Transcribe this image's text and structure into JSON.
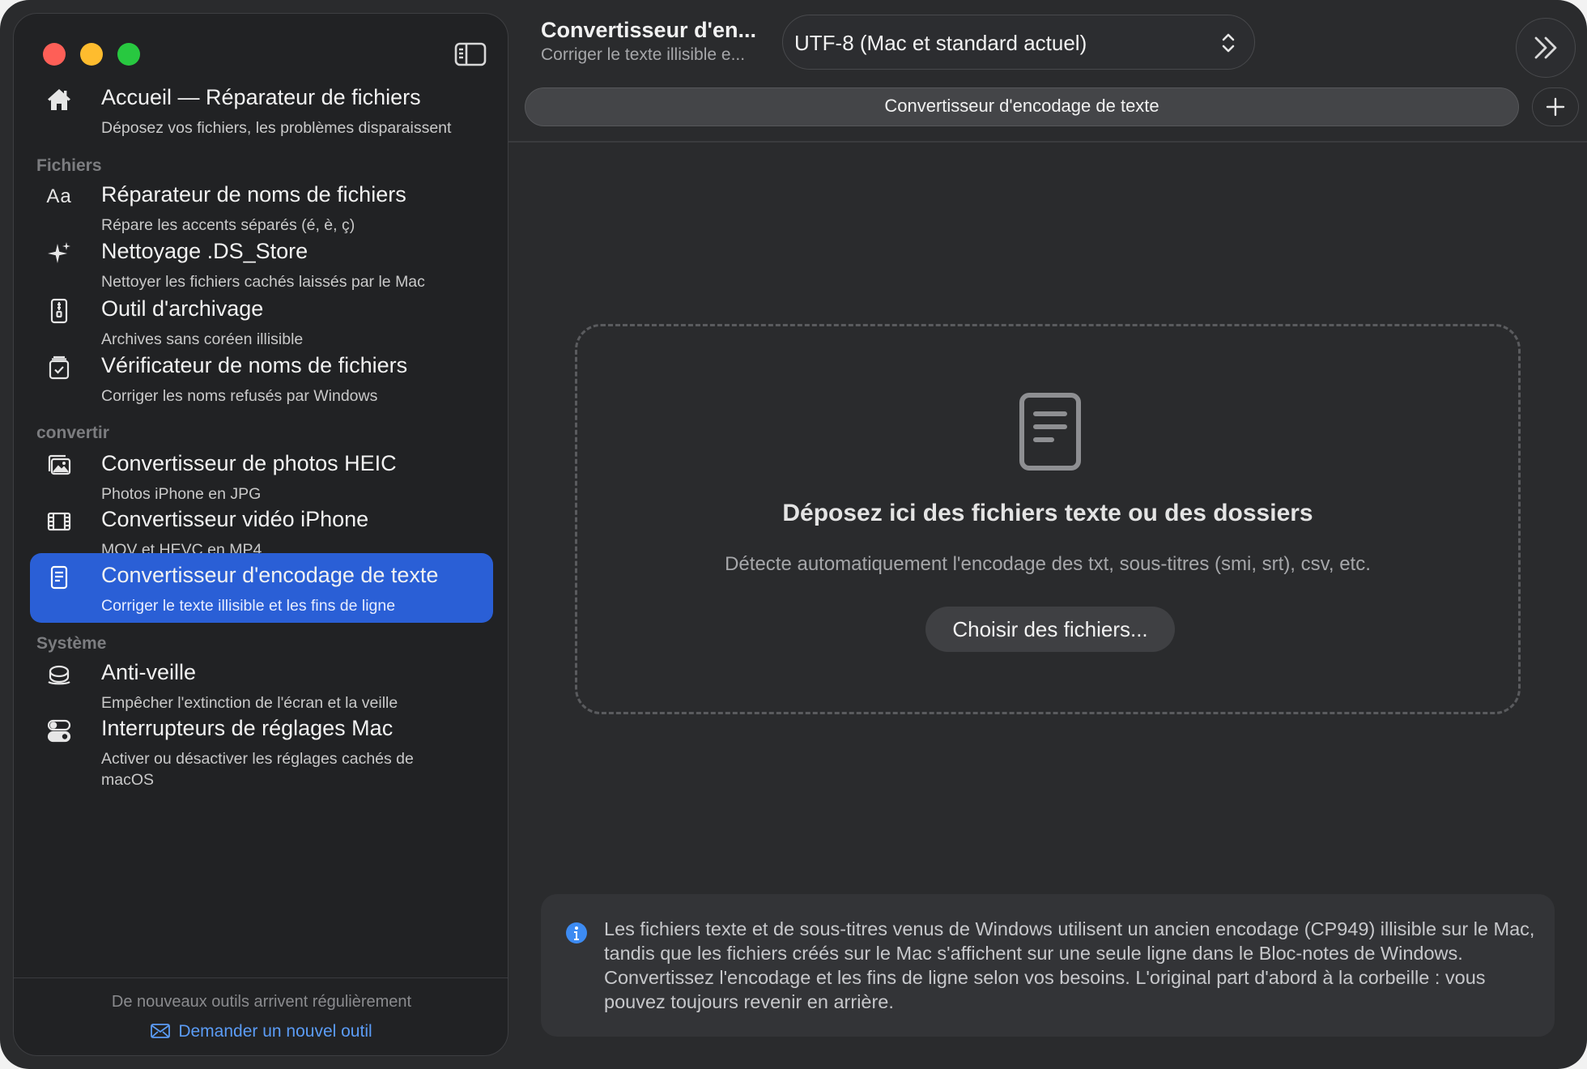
{
  "colors": {
    "accent": "#2a5fd6",
    "link": "#5b9cf6",
    "window_bg": "#2a2b2d",
    "sidebar_bg": "#212224",
    "traffic_red": "#fe5f57",
    "traffic_yellow": "#febc2e",
    "traffic_green": "#28c840"
  },
  "sidebar": {
    "home": {
      "icon": "house-icon",
      "title": "Accueil — Réparateur de fichiers",
      "subtitle": "Déposez vos fichiers, les problèmes disparaissent"
    },
    "sections": [
      {
        "label": "Fichiers",
        "items": [
          {
            "icon": "text-aa-icon",
            "title": "Réparateur de noms de fichiers",
            "subtitle": "Répare les accents séparés (é, è, ç)"
          },
          {
            "icon": "sparkles-icon",
            "title": "Nettoyage .DS_Store",
            "subtitle": "Nettoyer les fichiers cachés laissés par le Mac"
          },
          {
            "icon": "zip-archive-icon",
            "title": "Outil d'archivage",
            "subtitle": "Archives sans coréen illisible"
          },
          {
            "icon": "checklist-icon",
            "title": "Vérificateur de noms de fichiers",
            "subtitle": "Corriger les noms refusés par Windows"
          }
        ]
      },
      {
        "label": "convertir",
        "items": [
          {
            "icon": "photos-icon",
            "title": "Convertisseur de photos HEIC",
            "subtitle": "Photos iPhone en JPG"
          },
          {
            "icon": "film-icon",
            "title": "Convertisseur vidéo iPhone",
            "subtitle": "MOV et HEVC en MP4"
          },
          {
            "icon": "document-icon",
            "title": "Convertisseur d'encodage de texte",
            "subtitle": "Corriger le texte illisible et les fins de ligne",
            "selected": true
          }
        ]
      },
      {
        "label": "Système",
        "items": [
          {
            "icon": "sleep-icon",
            "title": "Anti-veille",
            "subtitle": "Empêcher l'extinction de l'écran et la veille"
          },
          {
            "icon": "toggles-icon",
            "title": "Interrupteurs de réglages Mac",
            "subtitle": "Activer ou désactiver les réglages cachés de macOS"
          }
        ]
      }
    ],
    "footer": {
      "note": "De nouveaux outils arrivent régulièrement",
      "link": "Demander un nouvel outil"
    }
  },
  "toolbar": {
    "title": "Convertisseur d'en...",
    "subtitle": "Corriger le texte illisible e...",
    "encoding_selected": "UTF-8 (Mac et standard actuel)"
  },
  "tabs": [
    {
      "label": "Convertisseur d'encodage de texte",
      "active": true
    }
  ],
  "dropzone": {
    "title": "Déposez ici des fichiers texte ou des dossiers",
    "subtitle": "Détecte automatiquement l'encodage des txt, sous-titres (smi, srt), csv, etc.",
    "button": "Choisir des fichiers..."
  },
  "info": {
    "text": "Les fichiers texte et de sous-titres venus de Windows utilisent un ancien encodage (CP949) illisible sur le Mac, tandis que les fichiers créés sur le Mac s'affichent sur une seule ligne dans le Bloc-notes de Windows. Convertissez l'encodage et les fins de ligne selon vos besoins. L'original part d'abord à la corbeille : vous pouvez toujours revenir en arrière."
  }
}
